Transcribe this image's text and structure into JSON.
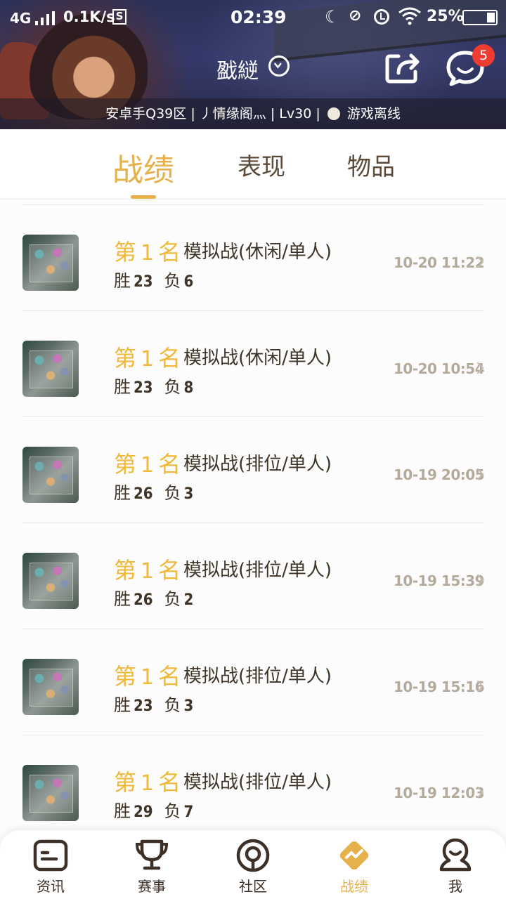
{
  "status_bar": {
    "network": "4G",
    "speed": "0.1K/s",
    "s_icon": "S",
    "time": "02:39",
    "battery": "25%",
    "battery_level": 0.25
  },
  "header": {
    "player_name": "戤縌",
    "server": "安卓手Q39区",
    "separator": "|",
    "guild": "丿情缘阁灬",
    "level": "Lv30",
    "status": "游戏离线",
    "message_badge": "5"
  },
  "tabs": [
    {
      "label": "战绩",
      "active": true
    },
    {
      "label": "表现",
      "active": false
    },
    {
      "label": "物品",
      "active": false
    }
  ],
  "matches": [
    {
      "rank_prefix": "第",
      "rank": "1",
      "rank_suffix": "名",
      "mode": "模拟战(休闲/单人)",
      "win_label": "胜",
      "wins": "23",
      "loss_label": "负",
      "losses": "6",
      "time": "10-20 11:22"
    },
    {
      "rank_prefix": "第",
      "rank": "1",
      "rank_suffix": "名",
      "mode": "模拟战(休闲/单人)",
      "win_label": "胜",
      "wins": "23",
      "loss_label": "负",
      "losses": "8",
      "time": "10-20 10:54"
    },
    {
      "rank_prefix": "第",
      "rank": "1",
      "rank_suffix": "名",
      "mode": "模拟战(排位/单人)",
      "win_label": "胜",
      "wins": "26",
      "loss_label": "负",
      "losses": "3",
      "time": "10-19 20:05"
    },
    {
      "rank_prefix": "第",
      "rank": "1",
      "rank_suffix": "名",
      "mode": "模拟战(排位/单人)",
      "win_label": "胜",
      "wins": "26",
      "loss_label": "负",
      "losses": "2",
      "time": "10-19 15:39"
    },
    {
      "rank_prefix": "第",
      "rank": "1",
      "rank_suffix": "名",
      "mode": "模拟战(排位/单人)",
      "win_label": "胜",
      "wins": "23",
      "loss_label": "负",
      "losses": "3",
      "time": "10-19 15:16"
    },
    {
      "rank_prefix": "第",
      "rank": "1",
      "rank_suffix": "名",
      "mode": "模拟战(排位/单人)",
      "win_label": "胜",
      "wins": "29",
      "loss_label": "负",
      "losses": "7",
      "time": "10-19 12:03"
    }
  ],
  "bottom_nav": [
    {
      "label": "资讯",
      "icon": "news-icon",
      "active": false
    },
    {
      "label": "赛事",
      "icon": "trophy-icon",
      "active": false
    },
    {
      "label": "社区",
      "icon": "community-icon",
      "active": false
    },
    {
      "label": "战绩",
      "icon": "record-icon",
      "active": true
    },
    {
      "label": "我",
      "icon": "profile-icon",
      "active": false
    }
  ],
  "colors": {
    "accent": "#e6b04a",
    "rank": "#f0b93a",
    "badge": "#f03c30",
    "text_dark": "#3f3428",
    "text_muted": "#b4aa9c"
  }
}
